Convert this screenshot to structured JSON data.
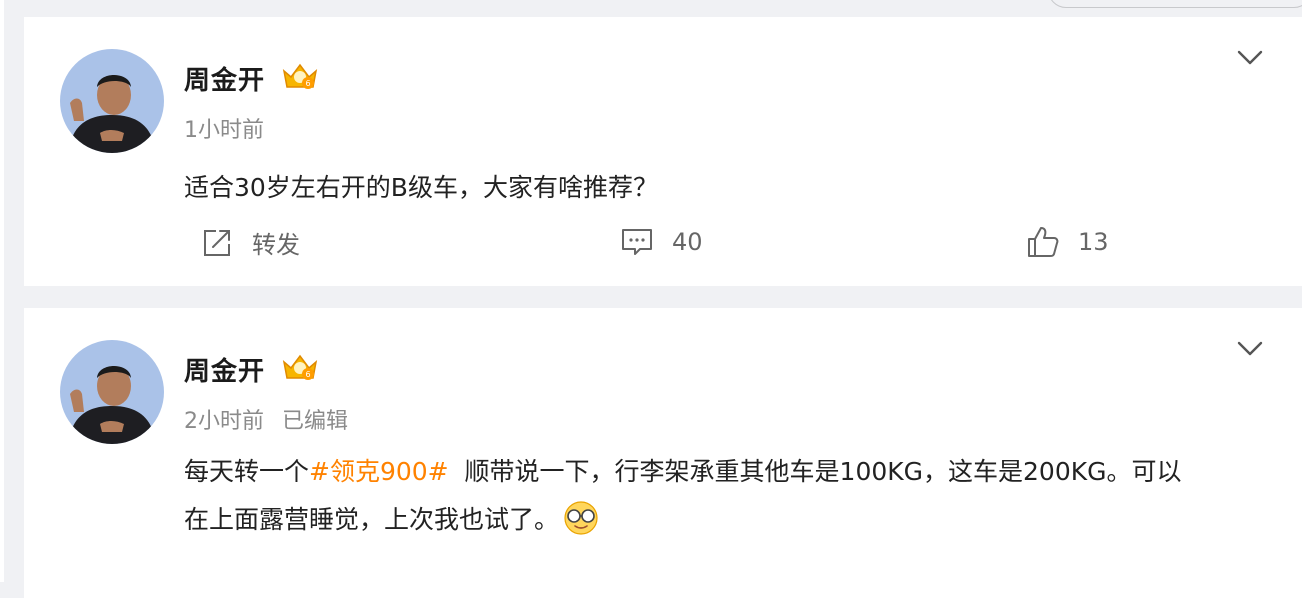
{
  "posts": [
    {
      "author": "周金开",
      "time": "1小时前",
      "content": "适合30岁左右开的B级车，大家有啥推荐？",
      "repost_label": "转发",
      "comments_count": "40",
      "likes_count": "13"
    },
    {
      "author": "周金开",
      "time": "2小时前",
      "edited": "已编辑",
      "content_before": "每天转一个",
      "topic": "#领克900#",
      "content_after": "  顺带说一下，行李架承重其他车是100KG，这车是200KG。可以在上面露营睡觉，上次我也试了。",
      "emoji": "smiling-glasses-emoji"
    }
  ],
  "colors": {
    "topic": "#ff8200",
    "background": "#f0f1f4",
    "card": "#ffffff",
    "meta": "#8a8a8a"
  },
  "icons": [
    "gold-vip-badge-icon",
    "chevron-down-icon",
    "repost-icon",
    "comment-icon",
    "like-icon"
  ]
}
